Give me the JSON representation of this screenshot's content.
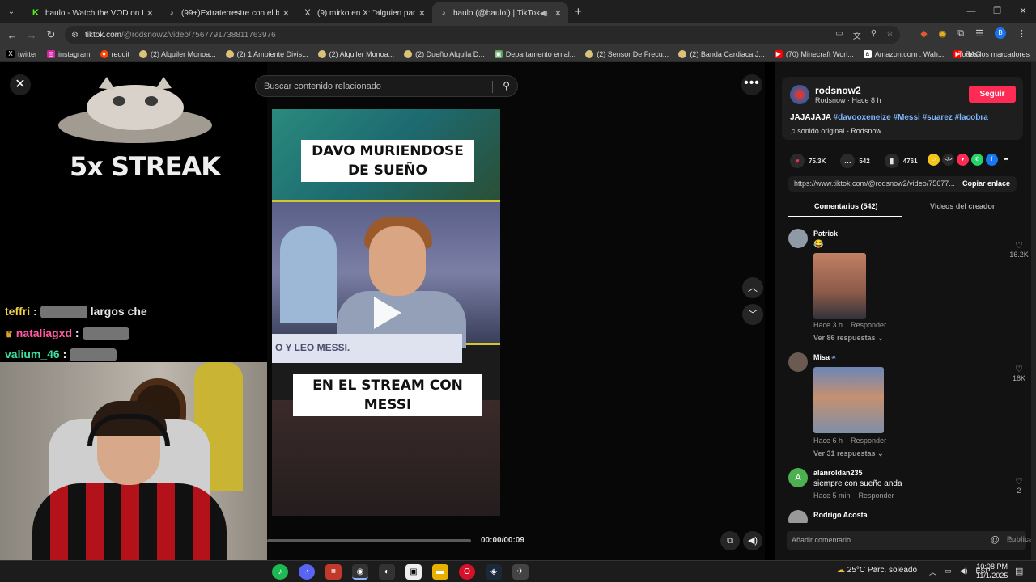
{
  "browser": {
    "tabs": [
      {
        "title": "baulo - Watch the VOD on Kick",
        "favicon": "K",
        "active": false
      },
      {
        "title": "(99+)Extraterrestre con el balón",
        "favicon": "♪",
        "active": false
      },
      {
        "title": "(9) mirko en X: \"alguien para te",
        "favicon": "X",
        "active": false
      },
      {
        "title": "baulo (@baulol) | TikTok",
        "favicon": "♪",
        "active": true
      }
    ],
    "url_host": "tiktok.com",
    "url_path": "/@rodsnow2/video/7567791738811763976",
    "profile_initial": "B",
    "bookmarks": [
      {
        "label": "twitter",
        "icon": "X",
        "color": "#000000"
      },
      {
        "label": "instagram",
        "icon": "◎",
        "color": "#d6249f"
      },
      {
        "label": "reddit",
        "icon": "●",
        "color": "#ff4500"
      },
      {
        "label": "(2) Alquiler Monoa...",
        "icon": "●",
        "color": "#d9c27a"
      },
      {
        "label": "(2) 1 Ambiente Divis...",
        "icon": "●",
        "color": "#d9c27a"
      },
      {
        "label": "(2) Alquiler Monoa...",
        "icon": "●",
        "color": "#d9c27a"
      },
      {
        "label": "(2) Dueño Alquila D...",
        "icon": "●",
        "color": "#d9c27a"
      },
      {
        "label": "Departamento en al...",
        "icon": "▣",
        "color": "#5aa05a"
      },
      {
        "label": "(2) Sensor De Frecu...",
        "icon": "●",
        "color": "#d9c27a"
      },
      {
        "label": "(2) Banda Cardiaca J...",
        "icon": "●",
        "color": "#d9c27a"
      },
      {
        "label": "(70) Minecraft Worl...",
        "icon": "▶",
        "color": "#ff0000"
      },
      {
        "label": "Amazon.com : Wah...",
        "icon": "a",
        "color": "#ffffff"
      },
      {
        "label": "RAG",
        "icon": "▶",
        "color": "#ff0000"
      }
    ],
    "bookmarks_more": "»",
    "all_bookmarks": "Todos los marcadores"
  },
  "stream": {
    "streak_text": "5x STREAK",
    "chat": [
      {
        "user": "teffri",
        "color": "#f0d24b",
        "suffix": "largos che"
      },
      {
        "user": "nataliagxd",
        "color": "#ff5aa0",
        "suffix": ""
      },
      {
        "user": "valium_46",
        "color": "#3fe0a0",
        "suffix": ""
      }
    ]
  },
  "player": {
    "search_placeholder": "Buscar contenido relacionado",
    "caption_top": "DAVO MURIENDOSE DE SUEÑO",
    "banner_text": "O Y LEO MESSI.",
    "caption_bottom": "EN EL STREAM CON MESSI",
    "time": "00:00/00:09",
    "progress": 0
  },
  "post": {
    "author": "rodsnow2",
    "author_sub": "Rodsnow · Hace 8 h",
    "follow_label": "Seguir",
    "description_prefix": "JAJAJAJA ",
    "hashtags": "#davooxeneize #Messi #suarez #lacobra",
    "music": "sonido original - Rodsnow",
    "likes": "75.3K",
    "comments_count": "542",
    "saves": "4761",
    "link": "https://www.tiktok.com/@rodsnow2/video/75677...",
    "copy_label": "Copiar enlace",
    "tab_comments": "Comentarios (542)",
    "tab_creator": "Videos del creador",
    "colors": {
      "follow": "#fe2c55",
      "hashtag": "#7fb6ff"
    }
  },
  "comments": [
    {
      "name": "Patrick",
      "text": "😂",
      "time": "Hace 3 h",
      "reply": "Responder",
      "replies": "Ver 86 respuestas",
      "likes": "16.2K"
    },
    {
      "name": "Misa",
      "text": "",
      "time": "Hace 6 h",
      "reply": "Responder",
      "replies": "Ver 31 respuestas",
      "likes": "18K"
    },
    {
      "name": "alanroldan235",
      "text": "siempre con sueño anda",
      "time": "Hace 5 min",
      "reply": "Responder",
      "replies": "",
      "likes": "2",
      "initial": "A"
    },
    {
      "name": "Rodrigo Acosta",
      "text": "",
      "time": "",
      "reply": "",
      "replies": "",
      "likes": ""
    }
  ],
  "composer": {
    "placeholder": "Añadir comentario...",
    "publish": "Publicar"
  },
  "taskbar": {
    "weather": "25°C  Parc. soleado",
    "lang": "ESP",
    "time": "10:08 PM",
    "date": "11/1/2025"
  }
}
